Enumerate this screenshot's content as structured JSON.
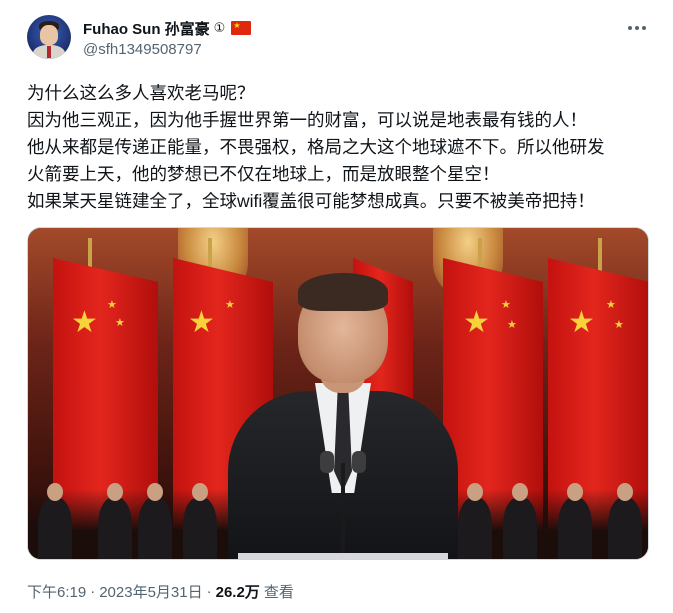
{
  "author": {
    "display_name": "Fuhao Sun 孙富豪",
    "name_suffix": "①",
    "handle": "@sfh1349508797",
    "flag_icon": "china-flag-icon"
  },
  "more_icon": "more-options-icon",
  "tweet": {
    "lines": [
      "为什么这么多人喜欢老马呢？",
      "因为他三观正，因为他手握世界第一的财富，可以说是地表最有钱的人！",
      "他从来都是传递正能量，不畏强权，格局之大这个地球遮不下。所以他研发",
      "火箭要上天，他的梦想已不仅在地球上，而是放眼整个星空！",
      "如果某天星链建全了，全球wifi覆盖很可能梦想成真。只要不被美帝把持！"
    ]
  },
  "meta": {
    "time": "下午6:19",
    "separator": "·",
    "date": "2023年5月31日",
    "views_count": "26.2万",
    "views_label": "查看"
  },
  "colors": {
    "text_primary": "#0f1419",
    "text_secondary": "#536471",
    "border": "#cfd9de",
    "flag_red": "#de2910",
    "flag_star": "#ffde00"
  }
}
